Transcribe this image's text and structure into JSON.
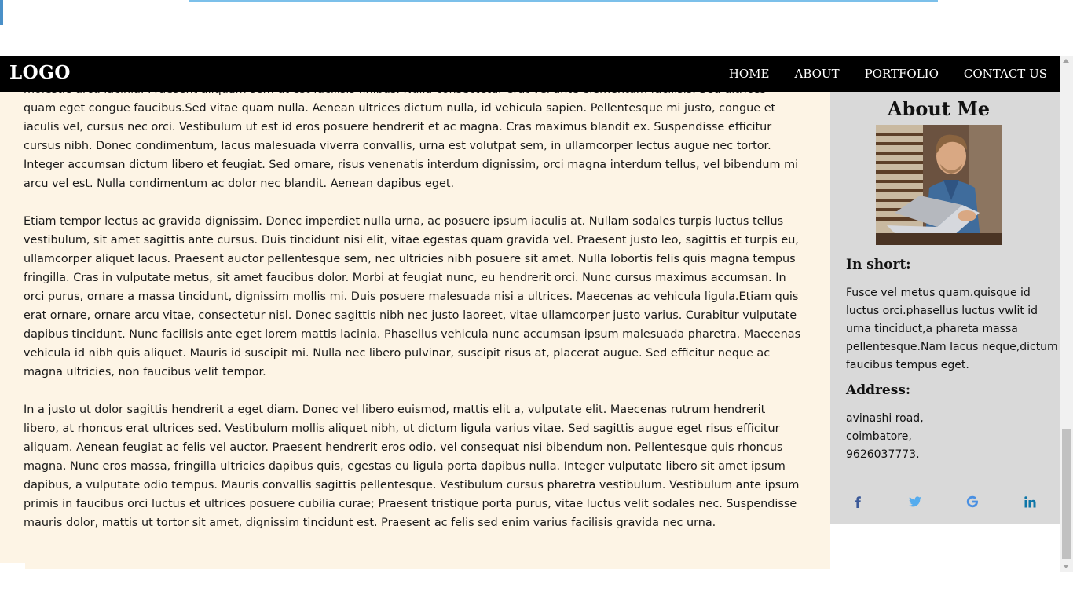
{
  "header": {
    "logo": "LOGO",
    "nav": [
      "HOME",
      "ABOUT",
      "PORTFOLIO",
      "CONTACT US"
    ]
  },
  "main": {
    "paragraphs": [
      "molestie arcu lacinia. Praesent aliquam sem ut est facilisis finibus. Nulla consectetur erat vel ante elementum facilisis. Sed ultrices quam eget congue faucibus.Sed vitae quam nulla. Aenean ultrices dictum nulla, id vehicula sapien. Pellentesque mi justo, congue et iaculis vel, cursus nec orci. Vestibulum ut est id eros posuere hendrerit et ac magna. Cras maximus blandit ex. Suspendisse efficitur cursus nibh. Donec condimentum, lacus malesuada viverra convallis, urna est volutpat sem, in ullamcorper lectus augue nec tortor. Integer accumsan dictum libero et feugiat. Sed ornare, risus venenatis interdum dignissim, orci magna interdum tellus, vel bibendum mi arcu vel est. Nulla condimentum ac dolor nec blandit. Aenean dapibus eget.",
      "Etiam tempor lectus ac gravida dignissim. Donec imperdiet nulla urna, ac posuere ipsum iaculis at. Nullam sodales turpis luctus tellus vestibulum, sit amet sagittis ante cursus. Duis tincidunt nisi elit, vitae egestas quam gravida vel. Praesent justo leo, sagittis et turpis eu, ullamcorper aliquet lacus. Praesent auctor pellentesque sem, nec ultricies nibh posuere sit amet. Nulla lobortis felis quis magna tempus fringilla. Cras in vulputate metus, sit amet faucibus dolor. Morbi at feugiat nunc, eu hendrerit orci. Nunc cursus maximus accumsan. In orci purus, ornare a massa tincidunt, dignissim mollis mi. Duis posuere malesuada nisi a ultrices. Maecenas ac vehicula ligula.Etiam quis erat ornare, ornare arcu vitae, consectetur nisl. Donec sagittis nibh nec justo laoreet, vitae ullamcorper justo varius. Curabitur vulputate dapibus tincidunt. Nunc facilisis ante eget lorem mattis lacinia. Phasellus vehicula nunc accumsan ipsum malesuada pharetra. Maecenas vehicula id nibh quis aliquet. Mauris id suscipit mi. Nulla nec libero pulvinar, suscipit risus at, placerat augue. Sed efficitur neque ac magna ultricies, non faucibus velit tempor.",
      "In a justo ut dolor sagittis hendrerit a eget diam. Donec vel libero euismod, mattis elit a, vulputate elit. Maecenas rutrum hendrerit libero, at rhoncus erat ultrices sed. Vestibulum mollis aliquet nibh, ut dictum ligula varius vitae. Sed sagittis augue eget risus efficitur aliquam. Aenean feugiat ac felis vel auctor. Praesent hendrerit eros odio, vel consequat nisi bibendum non. Pellentesque quis rhoncus magna. Nunc eros massa, fringilla ultricies dapibus quis, egestas eu ligula porta dapibus nulla. Integer vulputate libero sit amet ipsum dapibus, a vulputate odio tempus. Mauris convallis sagittis pellentesque. Vestibulum cursus pharetra vestibulum. Vestibulum ante ipsum primis in faucibus orci luctus et ultrices posuere cubilia curae; Praesent tristique porta purus, vitae luctus velit sodales nec. Suspendisse mauris dolor, mattis ut tortor sit amet, dignissim tincidunt est. Praesent ac felis sed enim varius facilisis gravida nec urna."
    ]
  },
  "aside": {
    "title": "About Me",
    "in_short_heading": "In short:",
    "in_short_text": "Fusce vel metus quam.quisque id luctus orci.phasellus luctus vwlit id urna tinciduct,a phareta massa pellentesque.Nam lacus neque,dictum faucibus tempus eget.",
    "address_heading": "Address:",
    "address_lines": [
      "avinashi road,",
      "coimbatore,",
      "9626037773."
    ],
    "social": [
      {
        "icon": "facebook-icon",
        "glyph": "f",
        "color": "#3b5998"
      },
      {
        "icon": "twitter-icon",
        "glyph": "t",
        "color": "#55acee"
      },
      {
        "icon": "google-icon",
        "glyph": "G",
        "color": "#4a90e2"
      },
      {
        "icon": "linkedin-icon",
        "glyph": "in",
        "color": "#0e76a8"
      }
    ]
  },
  "colors": {
    "header_bg": "#000000",
    "content_bg": "#fdf4e5",
    "aside_bg": "#d9d9d9"
  }
}
